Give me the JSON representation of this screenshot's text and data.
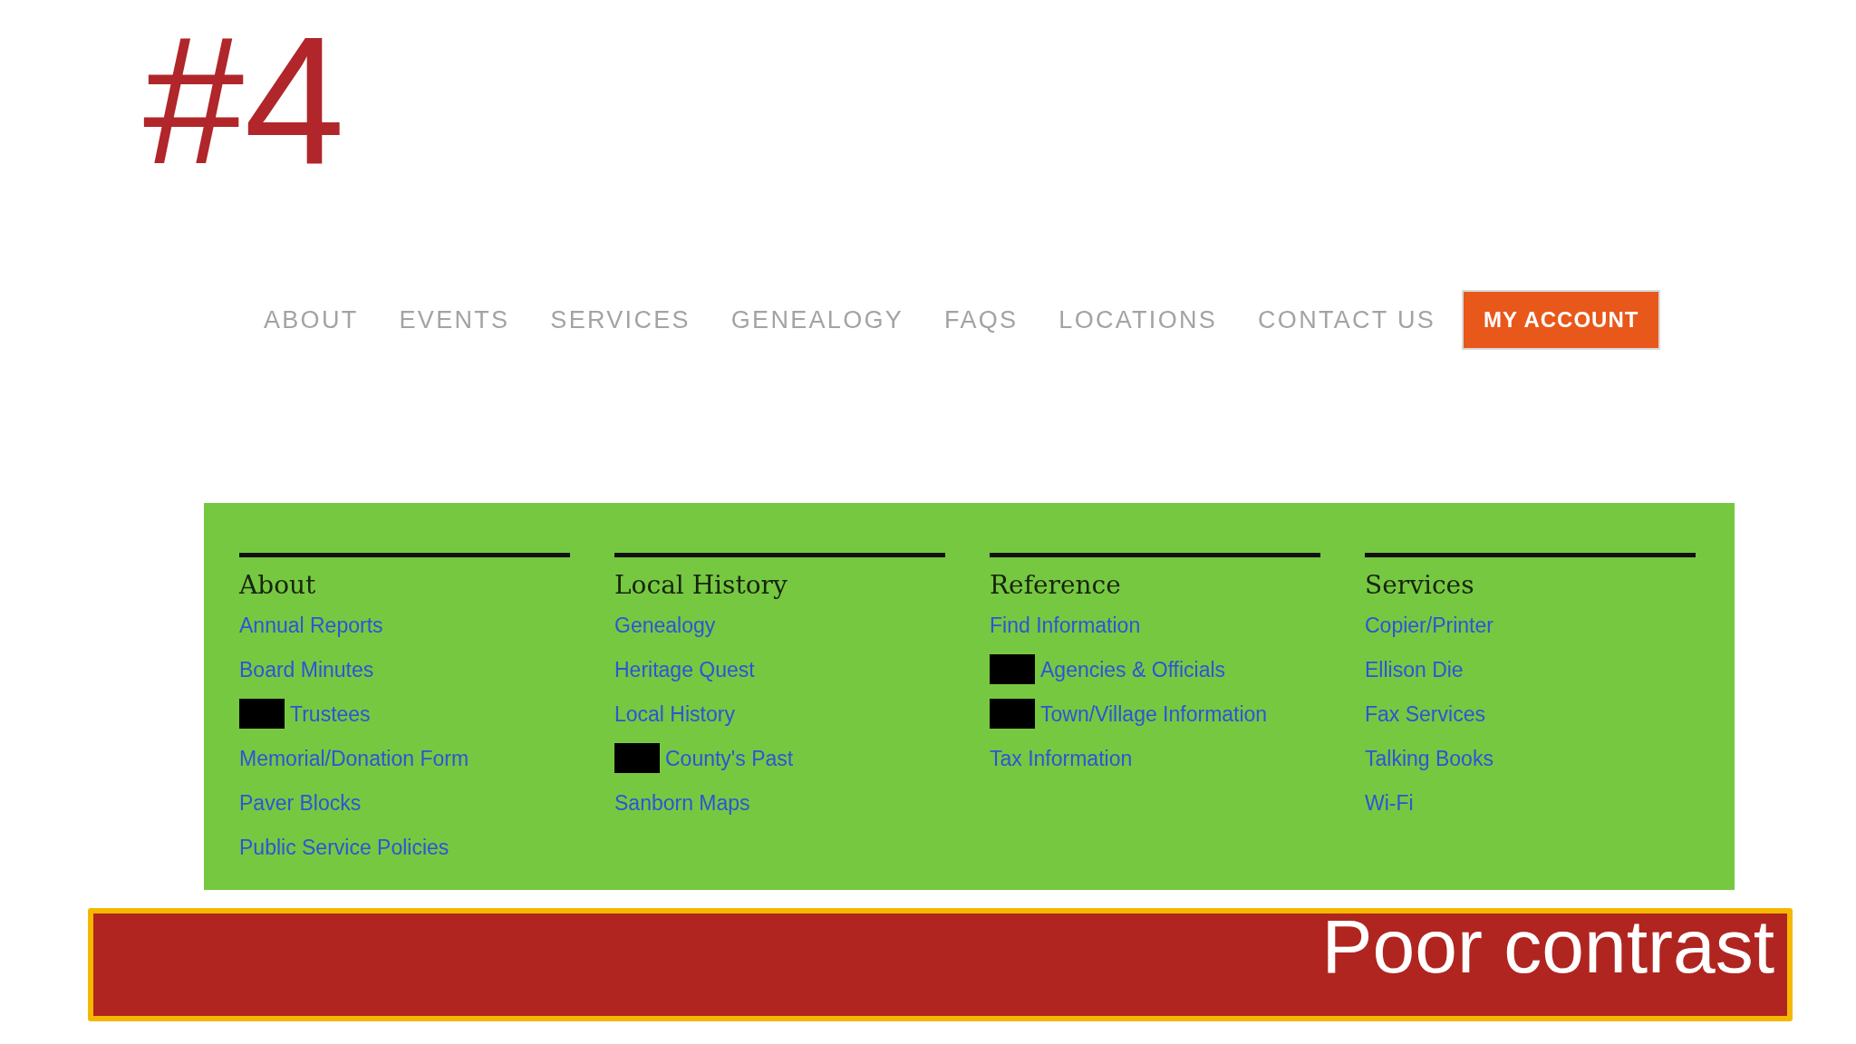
{
  "slide_number": "#4",
  "nav": {
    "links": [
      "ABOUT",
      "EVENTS",
      "SERVICES",
      "GENEALOGY",
      "FAQS",
      "LOCATIONS",
      "CONTACT US"
    ],
    "account_button": "MY ACCOUNT"
  },
  "menu_panel": {
    "columns": [
      {
        "heading": "About",
        "links": [
          {
            "text": "Annual Reports",
            "redacted": false
          },
          {
            "text": "Board Minutes",
            "redacted": false
          },
          {
            "text": "Trustees",
            "redacted": true
          },
          {
            "text": "Memorial/Donation Form",
            "redacted": false
          },
          {
            "text": "Paver Blocks",
            "redacted": false
          },
          {
            "text": "Public Service Policies",
            "redacted": false
          }
        ]
      },
      {
        "heading": "Local History",
        "links": [
          {
            "text": "Genealogy",
            "redacted": false
          },
          {
            "text": "Heritage Quest",
            "redacted": false
          },
          {
            "text": "Local History",
            "redacted": false
          },
          {
            "text": "County's Past",
            "redacted": true
          },
          {
            "text": "Sanborn Maps",
            "redacted": false
          }
        ]
      },
      {
        "heading": "Reference",
        "links": [
          {
            "text": "Find Information",
            "redacted": false
          },
          {
            "text": "Agencies & Officials",
            "redacted": true
          },
          {
            "text": "Town/Village Information",
            "redacted": true
          },
          {
            "text": "Tax Information",
            "redacted": false
          }
        ]
      },
      {
        "heading": "Services",
        "links": [
          {
            "text": "Copier/Printer",
            "redacted": false
          },
          {
            "text": "Ellison Die",
            "redacted": false
          },
          {
            "text": "Fax Services",
            "redacted": false
          },
          {
            "text": "Talking Books",
            "redacted": false
          },
          {
            "text": "Wi-Fi",
            "redacted": false
          }
        ]
      }
    ]
  },
  "caption": "Poor contrast"
}
